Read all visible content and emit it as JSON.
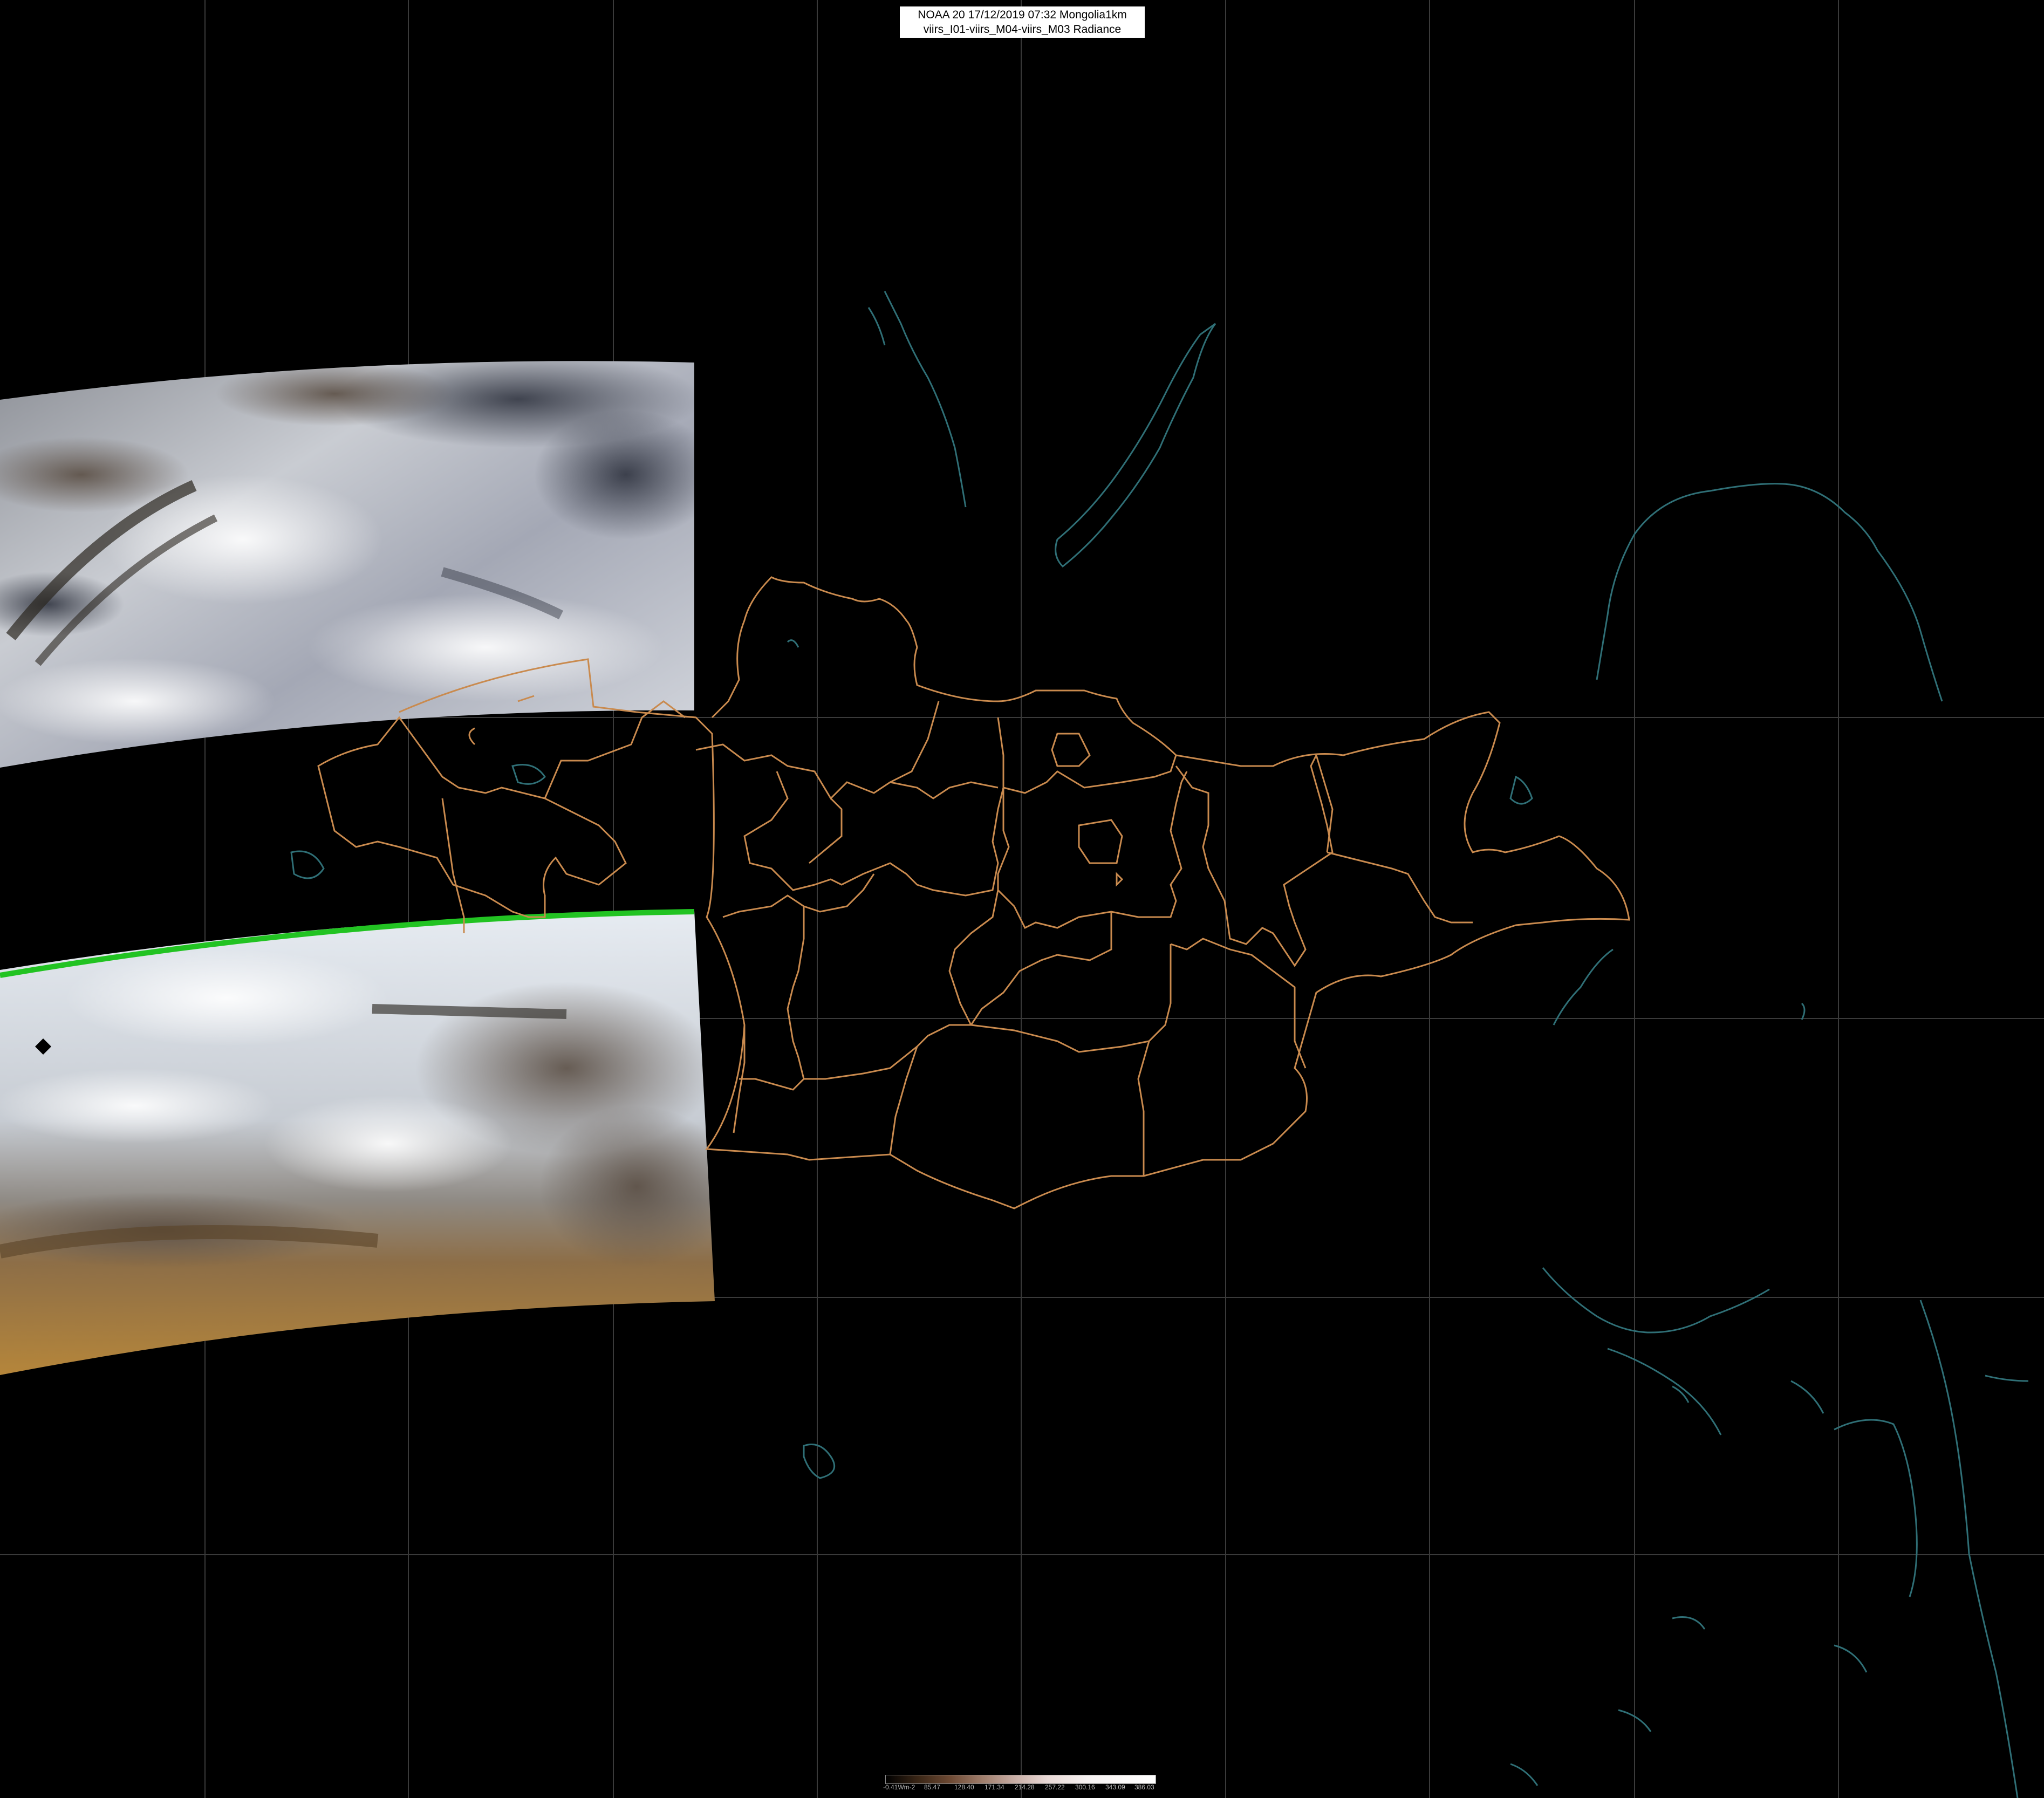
{
  "header": {
    "line1": "NOAA 20 17/12/2019 07:32 Mongolia1km",
    "line2": "viirs_I01-viirs_M04-viirs_M03 Radiance"
  },
  "legend": {
    "labels": [
      "-0.41Wm-2",
      "85.47",
      "128.40",
      "171.34",
      "214.28",
      "257.22",
      "300.16",
      "343.09",
      "386.03"
    ]
  },
  "map_layers": {
    "background": "#000000",
    "graticule_color": "#3a3a3a",
    "border_color": "#c98a4e",
    "coastline_color": "#2f6f76",
    "swath_edge_color": "#22c322"
  }
}
